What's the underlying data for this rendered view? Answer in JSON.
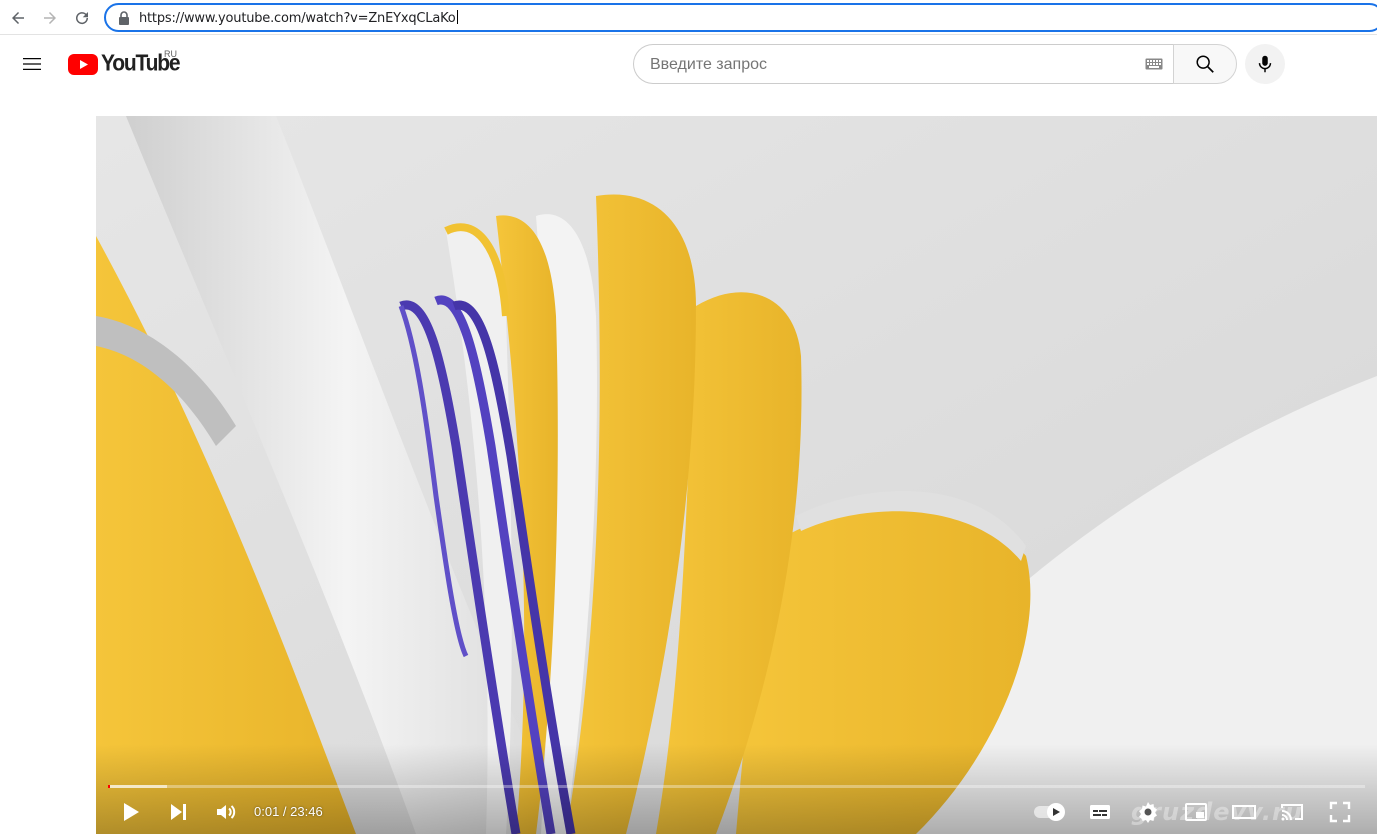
{
  "browser": {
    "url": "https://www.youtube.com/watch?v=ZnEYxqCLaKo"
  },
  "header": {
    "logo_text": "YouTube",
    "region": "RU",
    "search_placeholder": "Введите запрос"
  },
  "player": {
    "time_display": "0:01 / 23:46",
    "progress_played": 0.0007,
    "progress_buffered": 0.047,
    "watermark": "gruzdevv.ru",
    "accent_color": "#ff0000"
  },
  "icons": [
    "back-arrow-icon",
    "forward-arrow-icon",
    "reload-icon",
    "lock-icon",
    "hamburger-menu-icon",
    "youtube-logo-icon",
    "keyboard-icon",
    "search-icon",
    "microphone-icon",
    "play-icon",
    "next-icon",
    "volume-icon",
    "autoplay-toggle-icon",
    "subtitles-icon",
    "settings-gear-icon",
    "miniplayer-icon",
    "theater-mode-icon",
    "cast-icon",
    "fullscreen-icon"
  ]
}
